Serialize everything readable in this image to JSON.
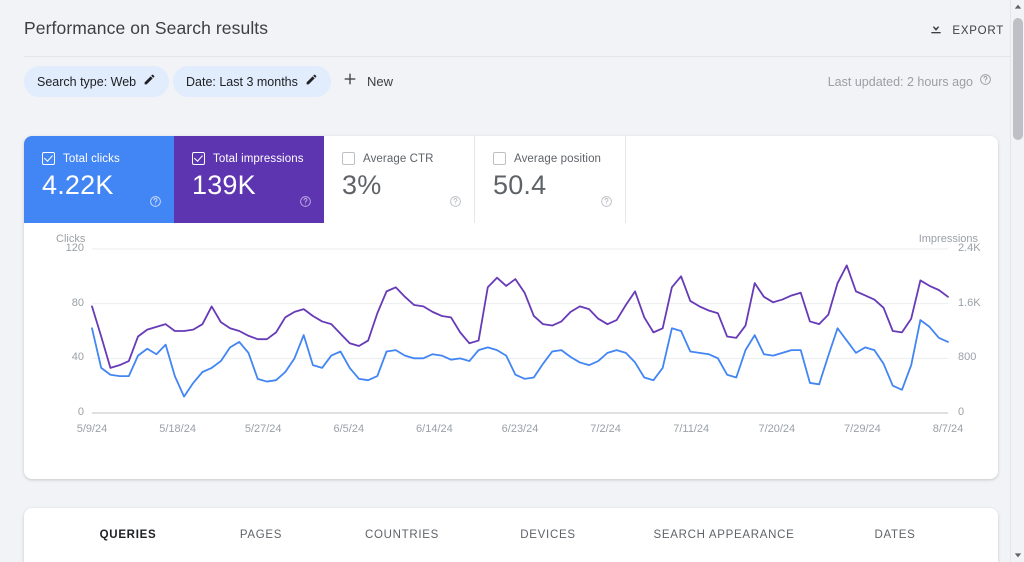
{
  "header": {
    "title": "Performance on Search results",
    "export_label": "EXPORT",
    "export_icon": "download-icon"
  },
  "filters": {
    "chips": [
      {
        "label": "Search type: Web",
        "icon": "pencil-edit-icon"
      },
      {
        "label": "Date: Last 3 months",
        "icon": "pencil-edit-icon"
      }
    ],
    "new_label": "New",
    "new_icon": "plus-icon",
    "last_updated": "Last updated: 2 hours ago",
    "last_updated_icon": "help-circle-icon"
  },
  "metrics": [
    {
      "label": "Total clicks",
      "value": "4.22K",
      "checked": true,
      "color": "#4285F4",
      "help_icon": "help-circle-icon"
    },
    {
      "label": "Total impressions",
      "value": "139K",
      "checked": true,
      "color": "#5E35B1",
      "help_icon": "help-circle-icon"
    },
    {
      "label": "Average CTR",
      "value": "3%",
      "checked": false,
      "color": "#FFFFFF",
      "help_icon": "help-circle-icon"
    },
    {
      "label": "Average position",
      "value": "50.4",
      "checked": false,
      "color": "#FFFFFF",
      "help_icon": "help-circle-icon"
    }
  ],
  "tabs": [
    {
      "label": "QUERIES",
      "active": true
    },
    {
      "label": "PAGES",
      "active": false
    },
    {
      "label": "COUNTRIES",
      "active": false
    },
    {
      "label": "DEVICES",
      "active": false
    },
    {
      "label": "SEARCH APPEARANCE",
      "active": false
    },
    {
      "label": "DATES",
      "active": false
    }
  ],
  "colors": {
    "clicks_line": "#4285F4",
    "impressions_line": "#673AB7",
    "page_bg": "#F1F3F6",
    "card_bg": "#FFFFFF",
    "chip_bg": "#E1ECFD"
  },
  "chart_data": {
    "type": "line",
    "title": "",
    "xlabel": "",
    "grid": true,
    "legend": "none",
    "x_tick_labels": [
      "5/9/24",
      "5/18/24",
      "5/27/24",
      "6/5/24",
      "6/14/24",
      "6/23/24",
      "7/2/24",
      "7/11/24",
      "7/20/24",
      "7/29/24",
      "8/7/24"
    ],
    "axes": [
      {
        "name": "Clicks",
        "side": "left",
        "ticks": [
          0,
          40,
          80,
          120
        ],
        "tick_labels": [
          "0",
          "40",
          "80",
          "120"
        ],
        "lim": [
          0,
          120
        ]
      },
      {
        "name": "Impressions",
        "side": "right",
        "ticks": [
          0,
          800,
          1600,
          2400
        ],
        "tick_labels": [
          "0",
          "800",
          "1.6K",
          "2.4K"
        ],
        "lim": [
          0,
          2400
        ]
      }
    ],
    "series": [
      {
        "name": "Total clicks",
        "axis": "left",
        "color": "#4285F4",
        "values": [
          62,
          33,
          28,
          27,
          27,
          42,
          47,
          43,
          50,
          27,
          12,
          22,
          30,
          33,
          38,
          48,
          52,
          44,
          25,
          23,
          24,
          30,
          40,
          57,
          35,
          33,
          42,
          45,
          33,
          25,
          24,
          27,
          45,
          46,
          42,
          40,
          40,
          43,
          42,
          39,
          40,
          38,
          46,
          48,
          46,
          42,
          28,
          25,
          26,
          36,
          45,
          46,
          41,
          37,
          35,
          38,
          44,
          46,
          44,
          37,
          26,
          24,
          33,
          62,
          60,
          45,
          44,
          43,
          40,
          28,
          26,
          46,
          57,
          43,
          42,
          44,
          46,
          46,
          22,
          21,
          42,
          62,
          53,
          44,
          48,
          46,
          36,
          20,
          17,
          35,
          68,
          63,
          55,
          52
        ]
      },
      {
        "name": "Total impressions",
        "axis": "right",
        "color": "#673AB7",
        "values": [
          1560,
          1120,
          660,
          700,
          760,
          1120,
          1220,
          1260,
          1300,
          1200,
          1200,
          1220,
          1300,
          1560,
          1330,
          1240,
          1200,
          1130,
          1080,
          1080,
          1180,
          1400,
          1480,
          1520,
          1420,
          1340,
          1300,
          1160,
          1020,
          980,
          1060,
          1460,
          1780,
          1840,
          1700,
          1580,
          1560,
          1480,
          1420,
          1400,
          1180,
          1020,
          1060,
          1840,
          1980,
          1860,
          1960,
          1760,
          1420,
          1300,
          1280,
          1340,
          1480,
          1560,
          1520,
          1380,
          1300,
          1360,
          1580,
          1780,
          1400,
          1180,
          1240,
          1840,
          2000,
          1640,
          1560,
          1500,
          1460,
          1120,
          1100,
          1280,
          1900,
          1700,
          1620,
          1660,
          1720,
          1760,
          1340,
          1300,
          1440,
          1900,
          2160,
          1780,
          1720,
          1660,
          1540,
          1200,
          1180,
          1380,
          1940,
          1860,
          1800,
          1700
        ]
      }
    ]
  }
}
